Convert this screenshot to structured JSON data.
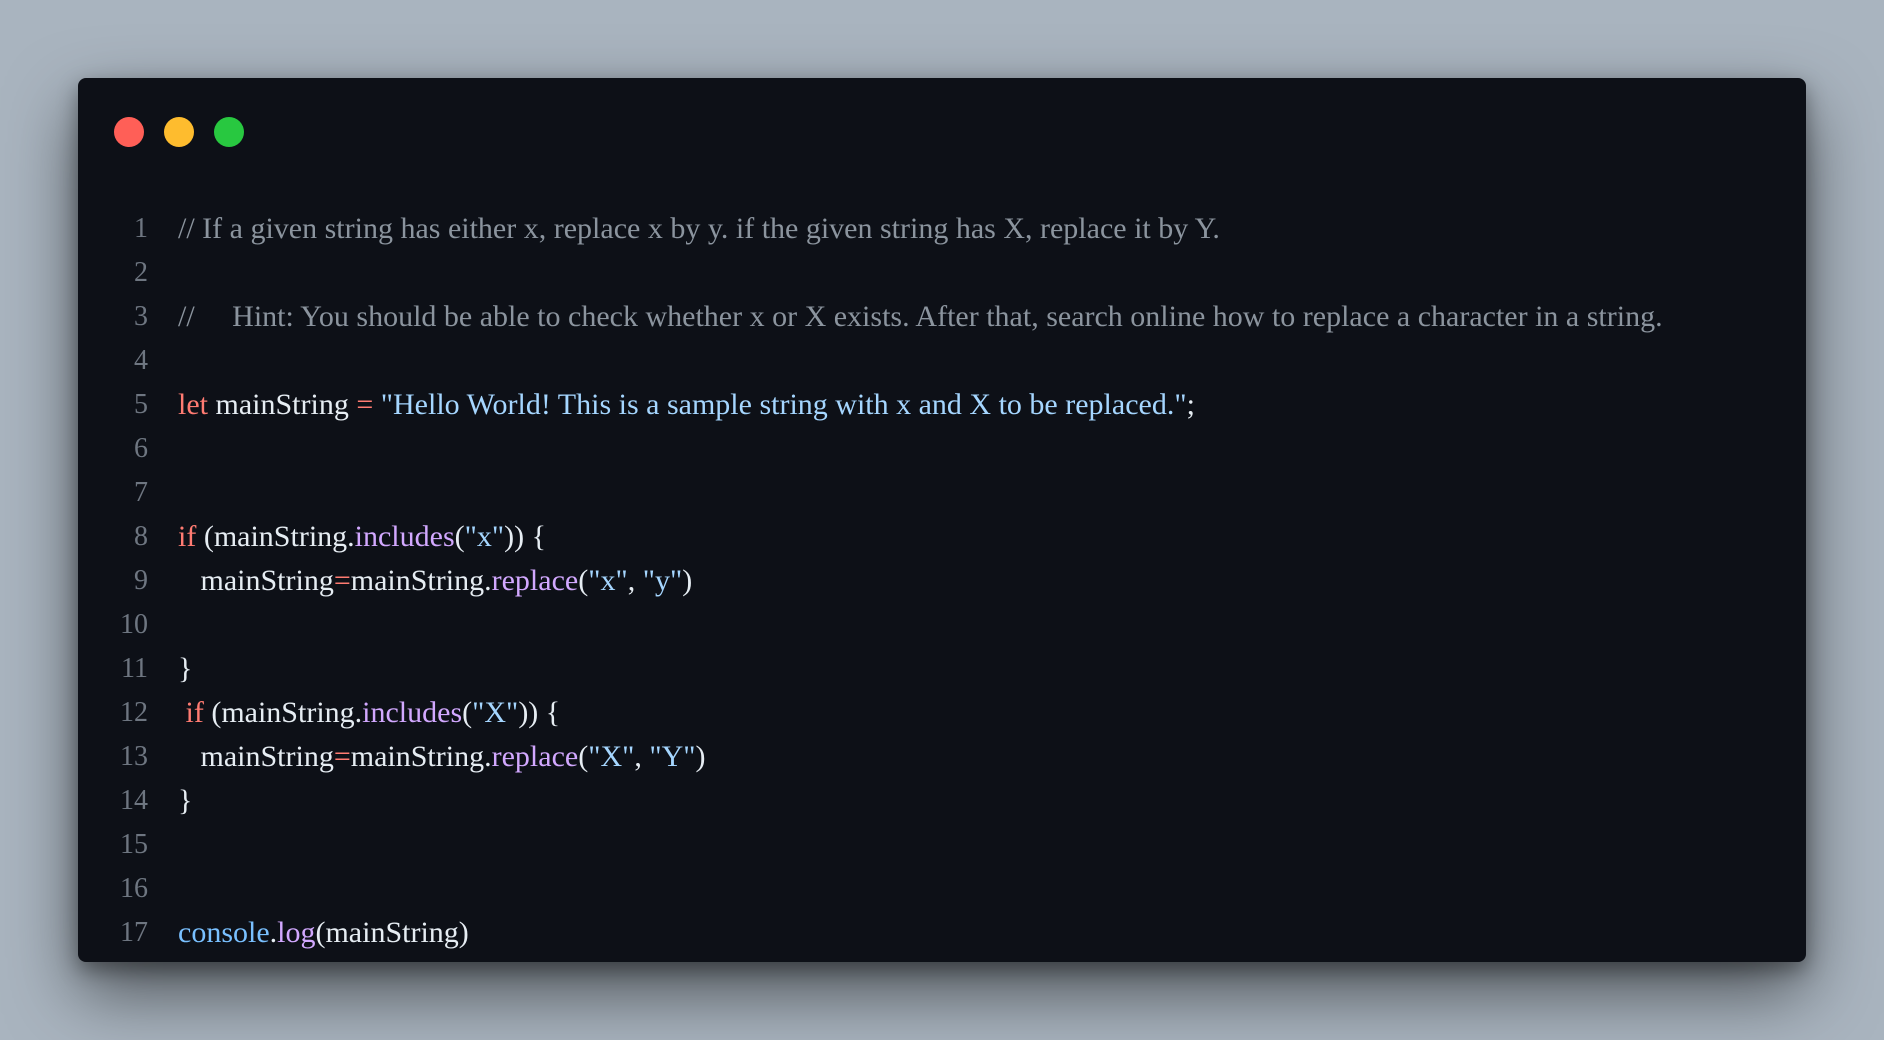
{
  "window": {
    "traffic_lights": {
      "close_color": "#ff5f57",
      "minimize_color": "#febc2e",
      "maximize_color": "#28c840"
    }
  },
  "code": {
    "lines": [
      {
        "number": "1",
        "tokens": [
          {
            "t": "comment",
            "v": "// If a given string has either x, replace x by y. if the given string has X, replace it by Y."
          }
        ]
      },
      {
        "number": "2",
        "tokens": []
      },
      {
        "number": "3",
        "tokens": [
          {
            "t": "comment",
            "v": "//     Hint: You should be able to check whether x or X exists. After that, search online how to replace a character in a string."
          }
        ]
      },
      {
        "number": "4",
        "tokens": []
      },
      {
        "number": "5",
        "tokens": [
          {
            "t": "kw",
            "v": "let"
          },
          {
            "t": "plain",
            "v": " mainString "
          },
          {
            "t": "kw",
            "v": "="
          },
          {
            "t": "plain",
            "v": " "
          },
          {
            "t": "str",
            "v": "\"Hello World! This is a sample string with x and X to be replaced.\""
          },
          {
            "t": "plain",
            "v": ";"
          }
        ]
      },
      {
        "number": "6",
        "tokens": []
      },
      {
        "number": "7",
        "tokens": []
      },
      {
        "number": "8",
        "tokens": [
          {
            "t": "kw",
            "v": "if"
          },
          {
            "t": "plain",
            "v": " (mainString."
          },
          {
            "t": "fn",
            "v": "includes"
          },
          {
            "t": "plain",
            "v": "("
          },
          {
            "t": "str",
            "v": "\"x\""
          },
          {
            "t": "plain",
            "v": ")) {"
          }
        ]
      },
      {
        "number": "9",
        "tokens": [
          {
            "t": "plain",
            "v": "   mainString"
          },
          {
            "t": "kw",
            "v": "="
          },
          {
            "t": "plain",
            "v": "mainString."
          },
          {
            "t": "fn",
            "v": "replace"
          },
          {
            "t": "plain",
            "v": "("
          },
          {
            "t": "str",
            "v": "\"x\""
          },
          {
            "t": "plain",
            "v": ", "
          },
          {
            "t": "str",
            "v": "\"y\""
          },
          {
            "t": "plain",
            "v": ")"
          }
        ]
      },
      {
        "number": "10",
        "tokens": []
      },
      {
        "number": "11",
        "tokens": [
          {
            "t": "plain",
            "v": "}"
          }
        ]
      },
      {
        "number": "12",
        "tokens": [
          {
            "t": "plain",
            "v": " "
          },
          {
            "t": "kw",
            "v": "if"
          },
          {
            "t": "plain",
            "v": " (mainString."
          },
          {
            "t": "fn",
            "v": "includes"
          },
          {
            "t": "plain",
            "v": "("
          },
          {
            "t": "str",
            "v": "\"X\""
          },
          {
            "t": "plain",
            "v": ")) {"
          }
        ]
      },
      {
        "number": "13",
        "tokens": [
          {
            "t": "plain",
            "v": "   mainString"
          },
          {
            "t": "kw",
            "v": "="
          },
          {
            "t": "plain",
            "v": "mainString."
          },
          {
            "t": "fn",
            "v": "replace"
          },
          {
            "t": "plain",
            "v": "("
          },
          {
            "t": "str",
            "v": "\"X\""
          },
          {
            "t": "plain",
            "v": ", "
          },
          {
            "t": "str",
            "v": "\"Y\""
          },
          {
            "t": "plain",
            "v": ")"
          }
        ]
      },
      {
        "number": "14",
        "tokens": [
          {
            "t": "plain",
            "v": "}"
          }
        ]
      },
      {
        "number": "15",
        "tokens": []
      },
      {
        "number": "16",
        "tokens": []
      },
      {
        "number": "17",
        "tokens": [
          {
            "t": "obj",
            "v": "console"
          },
          {
            "t": "plain",
            "v": "."
          },
          {
            "t": "fn",
            "v": "log"
          },
          {
            "t": "plain",
            "v": "(mainString)"
          }
        ]
      }
    ]
  }
}
